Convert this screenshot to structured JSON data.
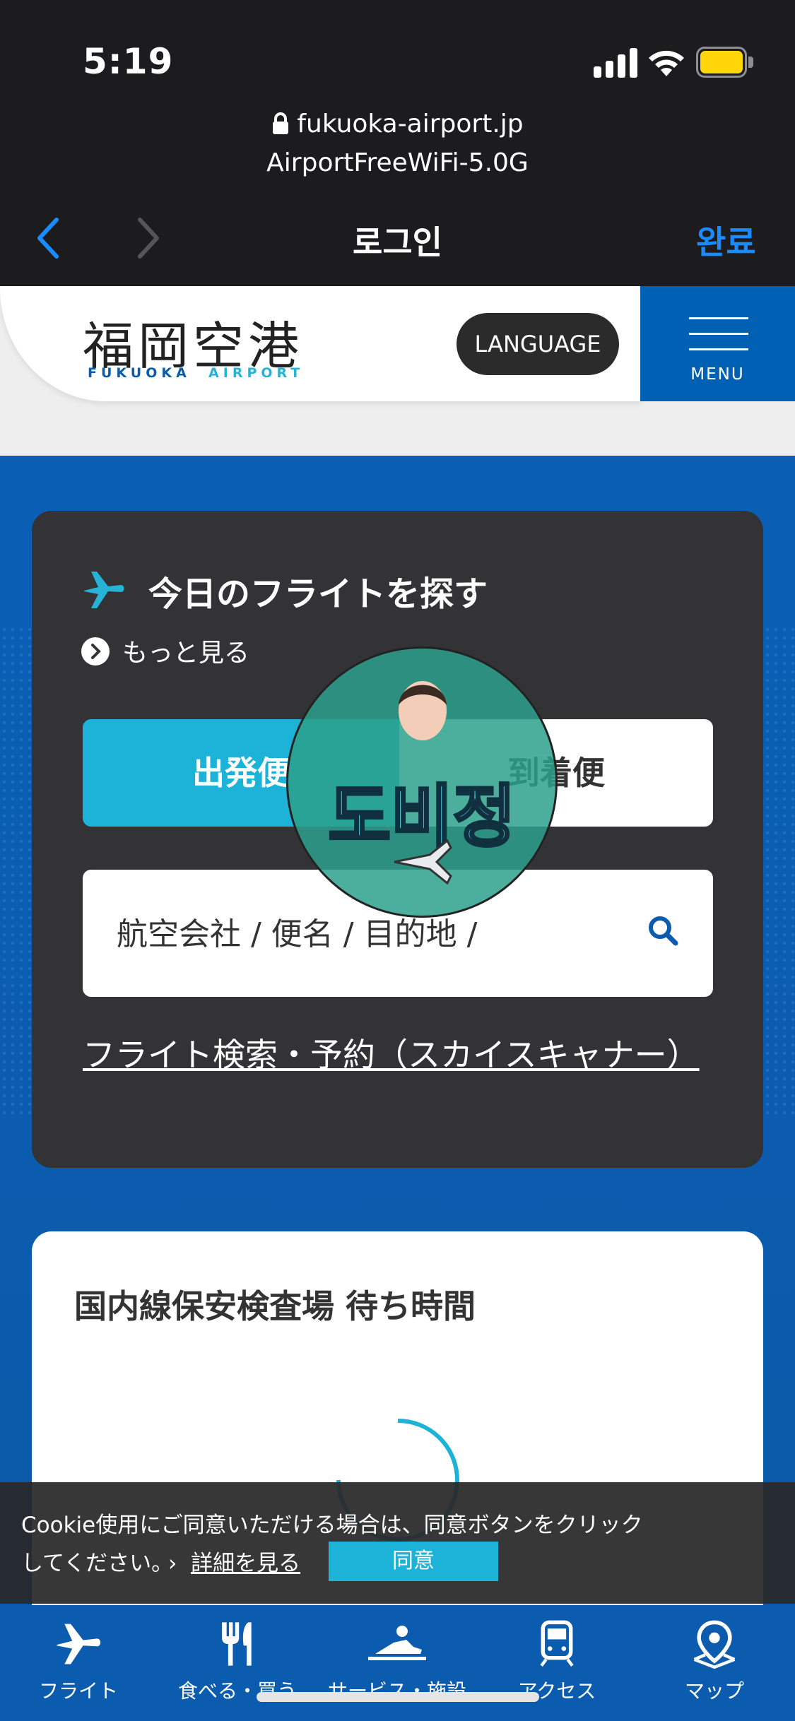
{
  "status_bar": {
    "time": "5:19"
  },
  "browser": {
    "url": "fukuoka-airport.jp",
    "ssid": "AirportFreeWiFi-5.0G",
    "title": "로그인",
    "done_label": "완료"
  },
  "site_header": {
    "logo_kanji": "福岡空港",
    "logo_en_left": "FUKUOKA",
    "logo_en_right": "AIRPORT",
    "language_label": "LANGUAGE",
    "menu_label": "MENU"
  },
  "flight_card": {
    "title": "今日のフライトを探す",
    "more_label": "もっと見る",
    "tab_departure": "出発便",
    "tab_arrival": "到着便",
    "search_placeholder": "航空会社 / 便名 / 目的地 /",
    "search_link": "フライト検索・予約（スカイスキャナー）"
  },
  "overlay_badge": {
    "text": "도비정"
  },
  "wait_card": {
    "title": "国内線保安検査場 待ち時間"
  },
  "cookie_banner": {
    "text": "Cookie使用にご同意いただける場合は、同意ボタンをクリックしてください。",
    "detail_label": "詳細を見る",
    "agree_label": "同意"
  },
  "tabbar": {
    "items": [
      {
        "label": "フライト",
        "icon": "airplane-icon"
      },
      {
        "label": "食べる・買う",
        "icon": "fork-knife-icon"
      },
      {
        "label": "サービス・施設",
        "icon": "service-icon"
      },
      {
        "label": "アクセス",
        "icon": "train-icon"
      },
      {
        "label": "マップ",
        "icon": "map-pin-icon"
      }
    ]
  },
  "colors": {
    "chrome_bg": "#1c1c1e",
    "link_blue": "#1a8cff",
    "brand_blue": "#0b5cae",
    "accent_cyan": "#1db2d8",
    "card_dark": "#333336"
  }
}
